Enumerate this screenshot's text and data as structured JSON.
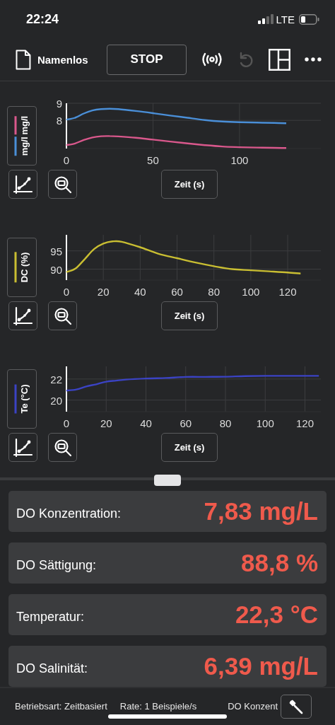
{
  "status_bar": {
    "time": "22:24",
    "network": "LTE"
  },
  "toolbar": {
    "title": "Namenlos",
    "stop_button": "STOP",
    "undo_disabled": true
  },
  "charts": [
    {
      "chart_data": {
        "type": "line",
        "xlabel": "Zeit (s)",
        "x": [
          0,
          5,
          10,
          15,
          20,
          25,
          30,
          40,
          50,
          60,
          70,
          80,
          90,
          100,
          110,
          120,
          127
        ],
        "xlim": [
          0,
          147
        ],
        "ylim": [
          6.35,
          9
        ],
        "grid": true,
        "xticks": [
          0,
          50,
          100
        ],
        "yticks": [
          8,
          9
        ],
        "series": [
          {
            "name": "mg/l",
            "color": "#4a8fd8",
            "values": [
              8.04,
              8.15,
              8.4,
              8.58,
              8.66,
              8.68,
              8.66,
              8.55,
              8.42,
              8.28,
              8.15,
              8.02,
              7.93,
              7.89,
              7.87,
              7.85,
              7.83
            ]
          },
          {
            "name": "mg/l",
            "color": "#d9588c",
            "values": [
              6.55,
              6.65,
              6.85,
              7.0,
              7.07,
              7.08,
              7.06,
              6.98,
              6.87,
              6.76,
              6.65,
              6.55,
              6.47,
              6.43,
              6.41,
              6.39,
              6.38
            ]
          }
        ]
      }
    },
    {
      "chart_data": {
        "type": "line",
        "xlabel": "Zeit (s)",
        "x": [
          0,
          5,
          10,
          15,
          20,
          25,
          30,
          40,
          50,
          60,
          70,
          80,
          90,
          100,
          110,
          120,
          127
        ],
        "xlim": [
          0,
          138
        ],
        "ylim": [
          87,
          99.4
        ],
        "grid": true,
        "xticks": [
          0,
          20,
          40,
          60,
          80,
          100,
          120
        ],
        "yticks": [
          90,
          95
        ],
        "series": [
          {
            "name": "DC (%)",
            "color": "#c9be32",
            "values": [
              89.2,
              90.2,
              92.8,
              95.5,
              97.0,
              97.6,
              97.5,
              96.0,
              94.2,
              93.0,
              91.8,
              90.8,
              90.0,
              89.7,
              89.4,
              89.1,
              88.8
            ]
          }
        ]
      }
    },
    {
      "chart_data": {
        "type": "line",
        "xlabel": "Zeit (s)",
        "x": [
          0,
          5,
          10,
          15,
          20,
          25,
          30,
          40,
          50,
          60,
          70,
          80,
          90,
          100,
          110,
          120,
          127
        ],
        "xlim": [
          0,
          128
        ],
        "ylim": [
          18.9,
          23.2
        ],
        "grid": true,
        "xticks": [
          0,
          20,
          40,
          60,
          80,
          100,
          120
        ],
        "yticks": [
          20,
          22
        ],
        "series": [
          {
            "name": "Te (°C)",
            "color": "#3b43c4",
            "values": [
              20.9,
              21.0,
              21.3,
              21.5,
              21.75,
              21.85,
              21.95,
              22.05,
              22.1,
              22.2,
              22.2,
              22.22,
              22.28,
              22.3,
              22.3,
              22.3,
              22.3
            ]
          }
        ]
      }
    }
  ],
  "readings": [
    {
      "label": "DO Konzentration:",
      "value": "7,83 mg/L"
    },
    {
      "label": "DO Sättigung:",
      "value": "88,8 %"
    },
    {
      "label": "Temperatur:",
      "value": "22,3 °C"
    },
    {
      "label": "DO Salinität:",
      "value": "6,39 mg/L"
    }
  ],
  "footer": {
    "mode": "Betriebsart: Zeitbasiert",
    "rate": "Rate: 1 Beispiele/s",
    "column_3": "DO Konzent"
  }
}
